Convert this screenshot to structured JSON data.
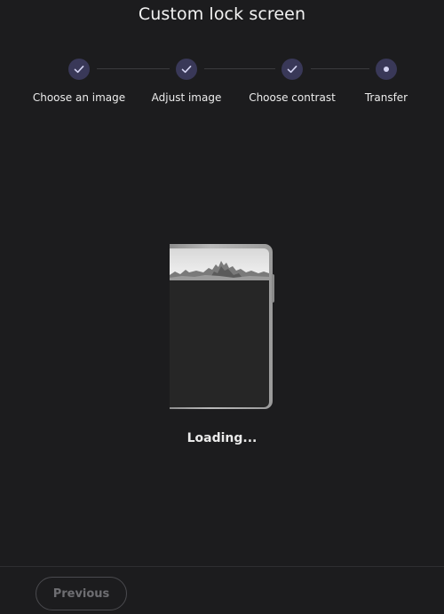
{
  "header": {
    "title": "Custom lock screen"
  },
  "stepper": {
    "steps": [
      {
        "label": "Choose an image",
        "state": "completed",
        "icon": "check-icon"
      },
      {
        "label": "Adjust image",
        "state": "completed",
        "icon": "check-icon"
      },
      {
        "label": "Choose contrast",
        "state": "completed",
        "icon": "check-icon"
      },
      {
        "label": "Transfer",
        "state": "current",
        "icon": "dot-icon"
      }
    ]
  },
  "preview": {
    "status": "Loading..."
  },
  "footer": {
    "previous_label": "Previous"
  },
  "colors": {
    "background": "#1c1c1e",
    "step_circle": "#393858",
    "step_check": "#d4d4f2",
    "text": "#f2f2f2",
    "disabled_text": "#6e6e72"
  }
}
